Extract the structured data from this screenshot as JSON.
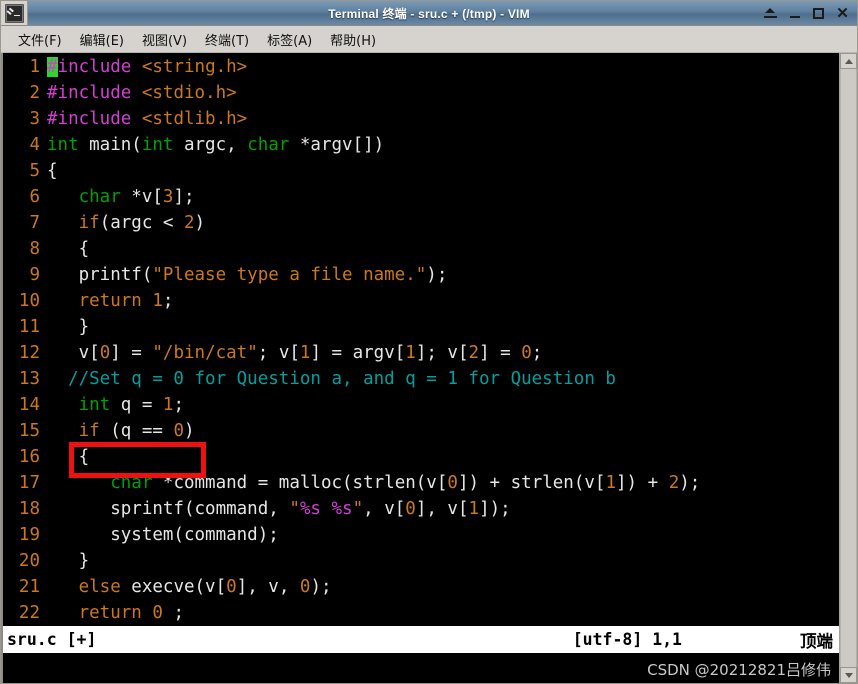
{
  "titlebar": {
    "title": "Terminal 终端 - sru.c + (/tmp) - VIM",
    "app_icon": "terminal-icon",
    "buttons": [
      {
        "name": "shade-button",
        "icon": "shade-icon",
        "label": "⏶"
      },
      {
        "name": "minimize-button",
        "icon": "minimize-icon",
        "label": "_"
      },
      {
        "name": "maximize-button",
        "icon": "maximize-icon",
        "label": "□"
      },
      {
        "name": "close-button",
        "icon": "close-icon",
        "label": "✕"
      }
    ]
  },
  "menubar": {
    "items": [
      {
        "label": "文件(F)"
      },
      {
        "label": "编辑(E)"
      },
      {
        "label": "视图(V)"
      },
      {
        "label": "终端(T)"
      },
      {
        "label": "标签(A)"
      },
      {
        "label": "帮助(H)"
      }
    ]
  },
  "editor": {
    "filename": "sru.c",
    "lines": [
      {
        "n": "1",
        "tokens": [
          {
            "t": "#",
            "c": "cursor"
          },
          {
            "t": "include",
            "c": "t-pre"
          },
          {
            "t": " ",
            "c": "t-plain"
          },
          {
            "t": "<string.h>",
            "c": "t-inc"
          }
        ]
      },
      {
        "n": "2",
        "tokens": [
          {
            "t": "#include",
            "c": "t-pre"
          },
          {
            "t": " ",
            "c": "t-plain"
          },
          {
            "t": "<stdio.h>",
            "c": "t-inc"
          }
        ]
      },
      {
        "n": "3",
        "tokens": [
          {
            "t": "#include",
            "c": "t-pre"
          },
          {
            "t": " ",
            "c": "t-plain"
          },
          {
            "t": "<stdlib.h>",
            "c": "t-inc"
          }
        ]
      },
      {
        "n": "4",
        "tokens": [
          {
            "t": "int",
            "c": "t-type"
          },
          {
            "t": " main(",
            "c": "t-plain"
          },
          {
            "t": "int",
            "c": "t-type"
          },
          {
            "t": " argc, ",
            "c": "t-plain"
          },
          {
            "t": "char",
            "c": "t-type"
          },
          {
            "t": " *argv[])",
            "c": "t-plain"
          }
        ]
      },
      {
        "n": "5",
        "tokens": [
          {
            "t": "{",
            "c": "t-plain"
          }
        ]
      },
      {
        "n": "6",
        "tokens": [
          {
            "t": "   ",
            "c": "t-plain"
          },
          {
            "t": "char",
            "c": "t-type"
          },
          {
            "t": " *v[",
            "c": "t-plain"
          },
          {
            "t": "3",
            "c": "t-num"
          },
          {
            "t": "];",
            "c": "t-plain"
          }
        ]
      },
      {
        "n": "7",
        "tokens": [
          {
            "t": "   ",
            "c": "t-plain"
          },
          {
            "t": "if",
            "c": "t-kw"
          },
          {
            "t": "(argc < ",
            "c": "t-plain"
          },
          {
            "t": "2",
            "c": "t-num"
          },
          {
            "t": ")",
            "c": "t-plain"
          }
        ]
      },
      {
        "n": "8",
        "tokens": [
          {
            "t": "   {",
            "c": "t-plain"
          }
        ]
      },
      {
        "n": "9",
        "tokens": [
          {
            "t": "   printf(",
            "c": "t-plain"
          },
          {
            "t": "\"Please type a file name.\"",
            "c": "t-str"
          },
          {
            "t": ");",
            "c": "t-plain"
          }
        ]
      },
      {
        "n": "10",
        "tokens": [
          {
            "t": "   ",
            "c": "t-plain"
          },
          {
            "t": "return",
            "c": "t-kw"
          },
          {
            "t": " ",
            "c": "t-plain"
          },
          {
            "t": "1",
            "c": "t-num"
          },
          {
            "t": ";",
            "c": "t-plain"
          }
        ]
      },
      {
        "n": "11",
        "tokens": [
          {
            "t": "   }",
            "c": "t-plain"
          }
        ]
      },
      {
        "n": "12",
        "tokens": [
          {
            "t": "   v[",
            "c": "t-plain"
          },
          {
            "t": "0",
            "c": "t-num"
          },
          {
            "t": "] = ",
            "c": "t-plain"
          },
          {
            "t": "\"/bin/cat\"",
            "c": "t-str"
          },
          {
            "t": "; v[",
            "c": "t-plain"
          },
          {
            "t": "1",
            "c": "t-num"
          },
          {
            "t": "] = argv[",
            "c": "t-plain"
          },
          {
            "t": "1",
            "c": "t-num"
          },
          {
            "t": "]; v[",
            "c": "t-plain"
          },
          {
            "t": "2",
            "c": "t-num"
          },
          {
            "t": "] = ",
            "c": "t-plain"
          },
          {
            "t": "0",
            "c": "t-num"
          },
          {
            "t": ";",
            "c": "t-plain"
          }
        ]
      },
      {
        "n": "13",
        "tokens": [
          {
            "t": "  //Set q = 0 for Question a, and q = 1 for Question b",
            "c": "t-cmt"
          }
        ]
      },
      {
        "n": "14",
        "tokens": [
          {
            "t": "   ",
            "c": "t-plain"
          },
          {
            "t": "int",
            "c": "t-type"
          },
          {
            "t": " q = ",
            "c": "t-plain"
          },
          {
            "t": "1",
            "c": "t-num"
          },
          {
            "t": ";",
            "c": "t-plain"
          }
        ]
      },
      {
        "n": "15",
        "tokens": [
          {
            "t": "   ",
            "c": "t-plain"
          },
          {
            "t": "if",
            "c": "t-kw"
          },
          {
            "t": " (q == ",
            "c": "t-plain"
          },
          {
            "t": "0",
            "c": "t-num"
          },
          {
            "t": ")",
            "c": "t-plain"
          }
        ]
      },
      {
        "n": "16",
        "tokens": [
          {
            "t": "   {",
            "c": "t-plain"
          }
        ]
      },
      {
        "n": "17",
        "tokens": [
          {
            "t": "      ",
            "c": "t-plain"
          },
          {
            "t": "char",
            "c": "t-type"
          },
          {
            "t": " *command = malloc(strlen(v[",
            "c": "t-plain"
          },
          {
            "t": "0",
            "c": "t-num"
          },
          {
            "t": "]) + strlen(v[",
            "c": "t-plain"
          },
          {
            "t": "1",
            "c": "t-num"
          },
          {
            "t": "]) + ",
            "c": "t-plain"
          },
          {
            "t": "2",
            "c": "t-num"
          },
          {
            "t": ");",
            "c": "t-plain"
          }
        ]
      },
      {
        "n": "18",
        "tokens": [
          {
            "t": "      sprintf(command, ",
            "c": "t-plain"
          },
          {
            "t": "\"",
            "c": "t-str"
          },
          {
            "t": "%s",
            "c": "t-fmt"
          },
          {
            "t": " ",
            "c": "t-str"
          },
          {
            "t": "%s",
            "c": "t-fmt"
          },
          {
            "t": "\"",
            "c": "t-str"
          },
          {
            "t": ", v[",
            "c": "t-plain"
          },
          {
            "t": "0",
            "c": "t-num"
          },
          {
            "t": "], v[",
            "c": "t-plain"
          },
          {
            "t": "1",
            "c": "t-num"
          },
          {
            "t": "]);",
            "c": "t-plain"
          }
        ]
      },
      {
        "n": "19",
        "tokens": [
          {
            "t": "      system(command);",
            "c": "t-plain"
          }
        ]
      },
      {
        "n": "20",
        "tokens": [
          {
            "t": "   }",
            "c": "t-plain"
          }
        ]
      },
      {
        "n": "21",
        "tokens": [
          {
            "t": "   ",
            "c": "t-plain"
          },
          {
            "t": "else",
            "c": "t-kw"
          },
          {
            "t": " execve(v[",
            "c": "t-plain"
          },
          {
            "t": "0",
            "c": "t-num"
          },
          {
            "t": "], v, ",
            "c": "t-plain"
          },
          {
            "t": "0",
            "c": "t-num"
          },
          {
            "t": ");",
            "c": "t-plain"
          }
        ]
      },
      {
        "n": "22",
        "tokens": [
          {
            "t": "   ",
            "c": "t-plain"
          },
          {
            "t": "return",
            "c": "t-kw"
          },
          {
            "t": " ",
            "c": "t-plain"
          },
          {
            "t": "0",
            "c": "t-num"
          },
          {
            "t": " ;",
            "c": "t-plain"
          }
        ]
      }
    ]
  },
  "annotation": {
    "name": "red-highlight-box",
    "color": "#ee1111",
    "target_line": "14"
  },
  "statusline": {
    "file": "sru.c [+]",
    "encoding_position": "[utf-8] 1,1",
    "scroll_state": "顶端"
  },
  "watermark": {
    "text": "CSDN @20212821吕修伟"
  },
  "scrollbar": {
    "up_arrow": "scroll-up-icon",
    "down_arrow": "scroll-down-icon"
  }
}
